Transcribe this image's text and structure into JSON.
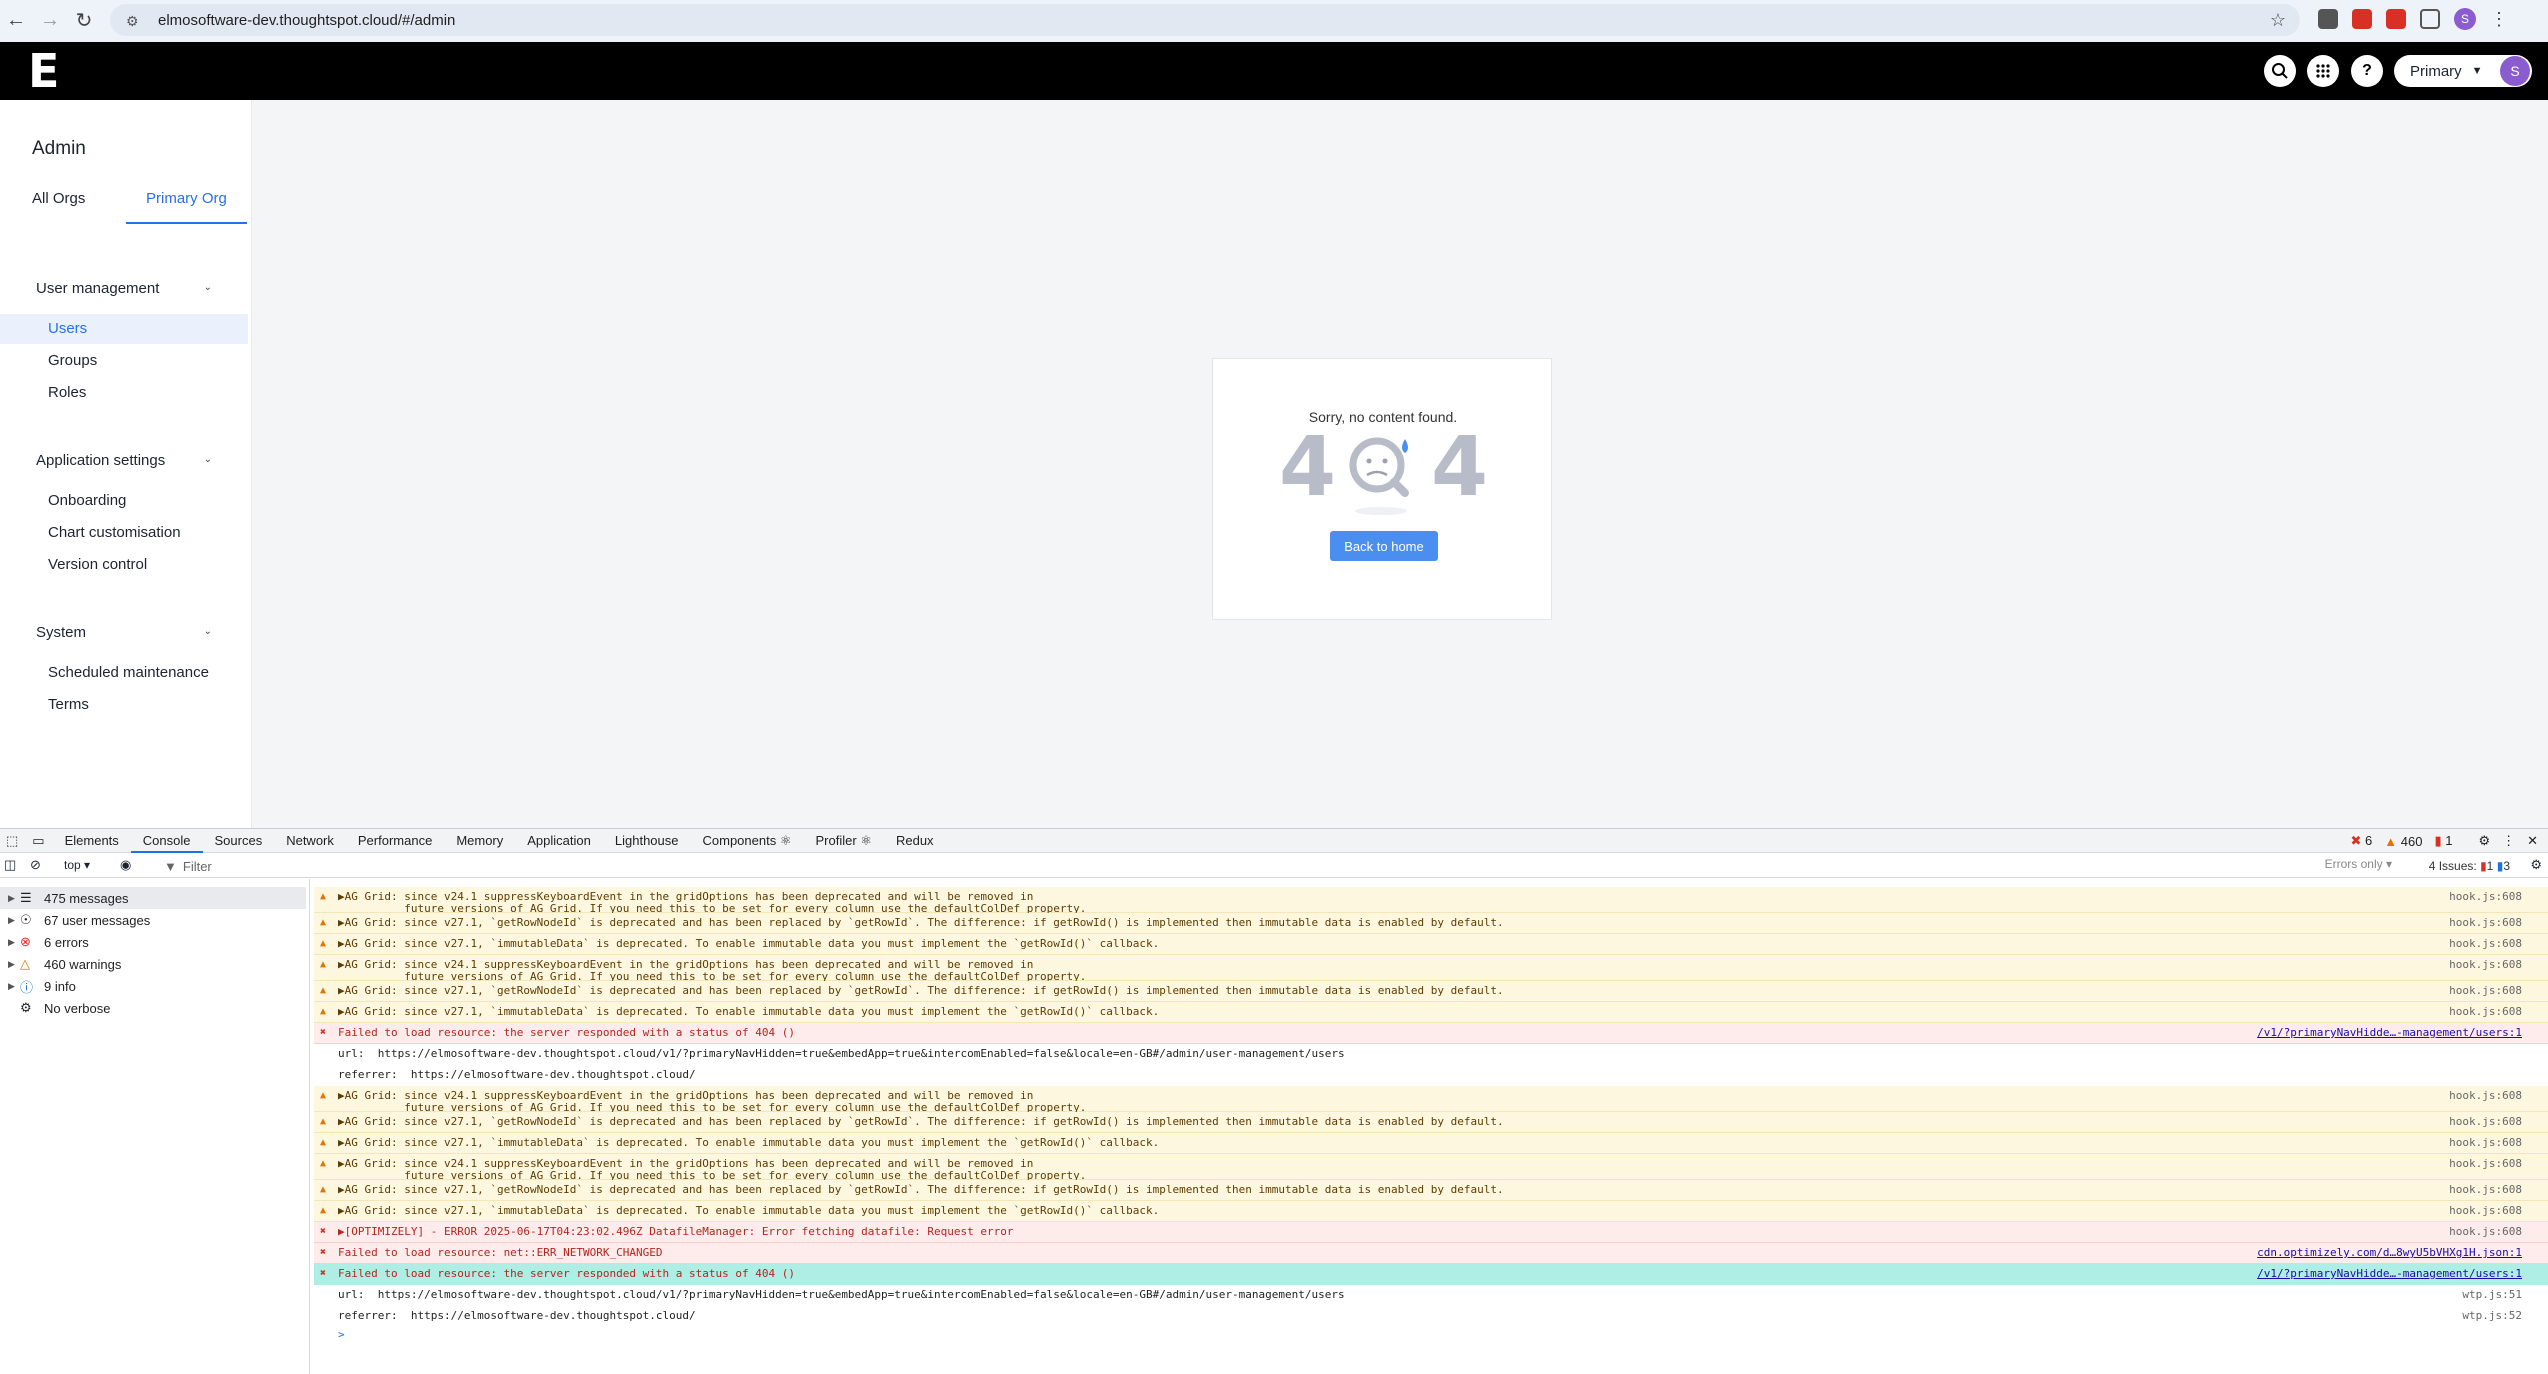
{
  "browser": {
    "url": "elmosoftware-dev.thoughtspot.cloud/#/admin",
    "profile_initial": "S"
  },
  "header": {
    "logo": "E",
    "org_label": "Primary",
    "avatar_initial": "S"
  },
  "sidebar": {
    "title": "Admin",
    "org_tabs": [
      "All Orgs",
      "Primary Org"
    ],
    "sections": [
      {
        "label": "User management",
        "items": [
          "Users",
          "Groups",
          "Roles"
        ]
      },
      {
        "label": "Application settings",
        "items": [
          "Onboarding",
          "Chart customisation",
          "Version control"
        ]
      },
      {
        "label": "System",
        "items": [
          "Scheduled maintenance",
          "Terms"
        ]
      }
    ]
  },
  "main": {
    "message": "Sorry, no content found.",
    "error_code_left": "4",
    "error_code_right": "4",
    "button": "Back to home"
  },
  "devtools": {
    "tabs": [
      "Elements",
      "Console",
      "Sources",
      "Network",
      "Performance",
      "Memory",
      "Application",
      "Lighthouse",
      "Components",
      "Profiler",
      "Redux"
    ],
    "error_count": "6",
    "warning_count": "460",
    "info_count": "1",
    "context": "top",
    "filter_placeholder": "Filter",
    "level": "Errors only",
    "issues_label": "4 Issues:",
    "issues_err": "1",
    "issues_info": "3",
    "summary": [
      {
        "label": "475 messages",
        "icon": "list"
      },
      {
        "label": "67 user messages",
        "icon": "user"
      },
      {
        "label": "6 errors",
        "icon": "error"
      },
      {
        "label": "460 warnings",
        "icon": "warning"
      },
      {
        "label": "9 info",
        "icon": "info"
      },
      {
        "label": "No verbose",
        "icon": "verbose"
      }
    ],
    "logs": [
      {
        "type": "warn",
        "text": "▶AG Grid: since v24.1 suppressKeyboardEvent in the gridOptions has been deprecated and will be removed in\n          future versions of AG Grid. If you need this to be set for every column use the defaultColDef property.",
        "src": "hook.js:608"
      },
      {
        "type": "warn",
        "text": "▶AG Grid: since v27.1, `getRowNodeId` is deprecated and has been replaced by `getRowId`. The difference: if getRowId() is implemented then immutable data is enabled by default.",
        "src": "hook.js:608"
      },
      {
        "type": "warn",
        "text": "▶AG Grid: since v27.1, `immutableData` is deprecated. To enable immutable data you must implement the `getRowId()` callback.",
        "src": "hook.js:608"
      },
      {
        "type": "warn",
        "text": "▶AG Grid: since v24.1 suppressKeyboardEvent in the gridOptions has been deprecated and will be removed in\n          future versions of AG Grid. If you need this to be set for every column use the defaultColDef property.",
        "src": "hook.js:608"
      },
      {
        "type": "warn",
        "text": "▶AG Grid: since v27.1, `getRowNodeId` is deprecated and has been replaced by `getRowId`. The difference: if getRowId() is implemented then immutable data is enabled by default.",
        "src": "hook.js:608"
      },
      {
        "type": "warn",
        "text": "▶AG Grid: since v27.1, `immutableData` is deprecated. To enable immutable data you must implement the `getRowId()` callback.",
        "src": "hook.js:608"
      },
      {
        "type": "err",
        "text": "Failed to load resource: the server responded with a status of 404 ()",
        "src": "/v1/?primaryNavHidde…-management/users:1"
      },
      {
        "type": "sub",
        "text": "url:  https://elmosoftware-dev.thoughtspot.cloud/v1/?primaryNavHidden=true&embedApp=true&intercomEnabled=false&locale=en-GB#/admin/user-management/users",
        "src": ""
      },
      {
        "type": "sub",
        "text": "referrer:  https://elmosoftware-dev.thoughtspot.cloud/",
        "src": ""
      },
      {
        "type": "warn",
        "text": "▶AG Grid: since v24.1 suppressKeyboardEvent in the gridOptions has been deprecated and will be removed in\n          future versions of AG Grid. If you need this to be set for every column use the defaultColDef property.",
        "src": "hook.js:608"
      },
      {
        "type": "warn",
        "text": "▶AG Grid: since v27.1, `getRowNodeId` is deprecated and has been replaced by `getRowId`. The difference: if getRowId() is implemented then immutable data is enabled by default.",
        "src": "hook.js:608"
      },
      {
        "type": "warn",
        "text": "▶AG Grid: since v27.1, `immutableData` is deprecated. To enable immutable data you must implement the `getRowId()` callback.",
        "src": "hook.js:608"
      },
      {
        "type": "warn",
        "text": "▶AG Grid: since v24.1 suppressKeyboardEvent in the gridOptions has been deprecated and will be removed in\n          future versions of AG Grid. If you need this to be set for every column use the defaultColDef property.",
        "src": "hook.js:608"
      },
      {
        "type": "warn",
        "text": "▶AG Grid: since v27.1, `getRowNodeId` is deprecated and has been replaced by `getRowId`. The difference: if getRowId() is implemented then immutable data is enabled by default.",
        "src": "hook.js:608"
      },
      {
        "type": "warn",
        "text": "▶AG Grid: since v27.1, `immutableData` is deprecated. To enable immutable data you must implement the `getRowId()` callback.",
        "src": "hook.js:608"
      },
      {
        "type": "err",
        "text": "▶[OPTIMIZELY] - ERROR 2025-06-17T04:23:02.496Z DatafileManager: Error fetching datafile: Request error",
        "src": "hook.js:608"
      },
      {
        "type": "err",
        "text": "Failed to load resource: net::ERR_NETWORK_CHANGED",
        "src": "cdn.optimizely.com/d…8wyU5bVHXg1H.json:1"
      },
      {
        "type": "hl",
        "text": "Failed to load resource: the server responded with a status of 404 ()",
        "src": "/v1/?primaryNavHidde…-management/users:1"
      },
      {
        "type": "sub",
        "text": "url:  https://elmosoftware-dev.thoughtspot.cloud/v1/?primaryNavHidden=true&embedApp=true&intercomEnabled=false&locale=en-GB#/admin/user-management/users",
        "src": "wtp.js:51"
      },
      {
        "type": "sub",
        "text": "referrer:  https://elmosoftware-dev.thoughtspot.cloud/",
        "src": "wtp.js:52"
      }
    ],
    "prompt": ">"
  }
}
